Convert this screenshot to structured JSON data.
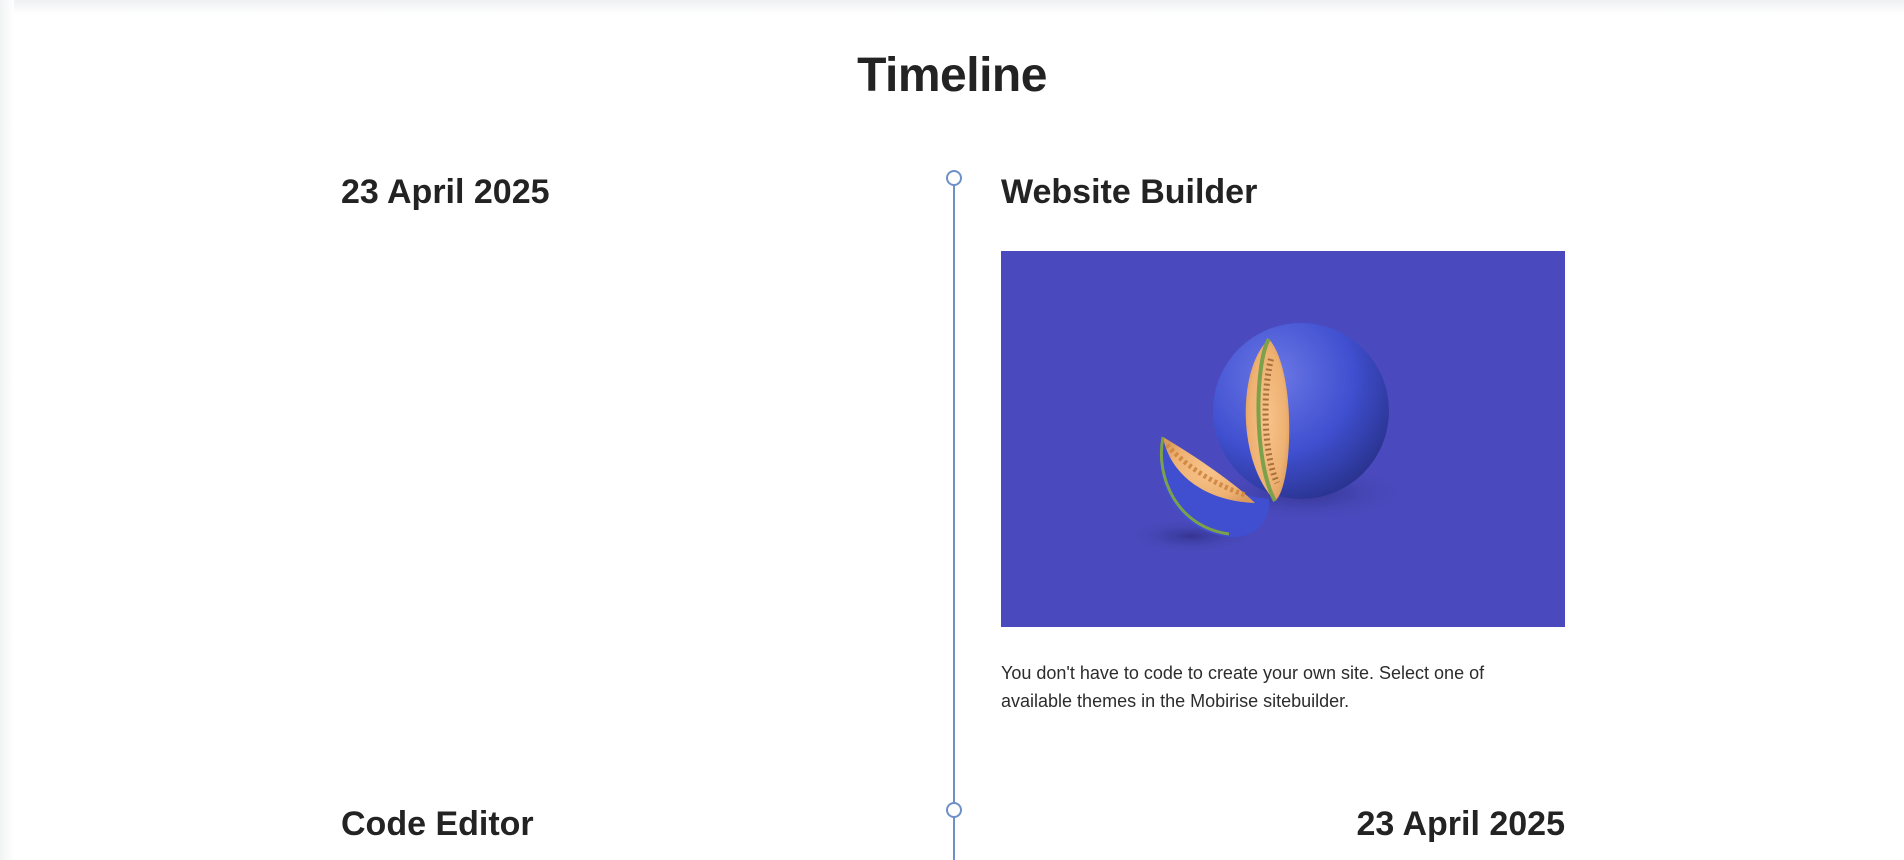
{
  "section": {
    "title": "Timeline"
  },
  "items": [
    {
      "date": "23 April 2025",
      "title": "Website Builder",
      "image_alt": "melon",
      "text": "You don't have to code to create your own site. Select one of available themes in the Mobirise sitebuilder."
    },
    {
      "date": "23 April 2025",
      "title": "Code Editor"
    }
  ],
  "colors": {
    "accent": "#6d90c8",
    "image_background": "#4a4abe",
    "heading": "#232323"
  }
}
